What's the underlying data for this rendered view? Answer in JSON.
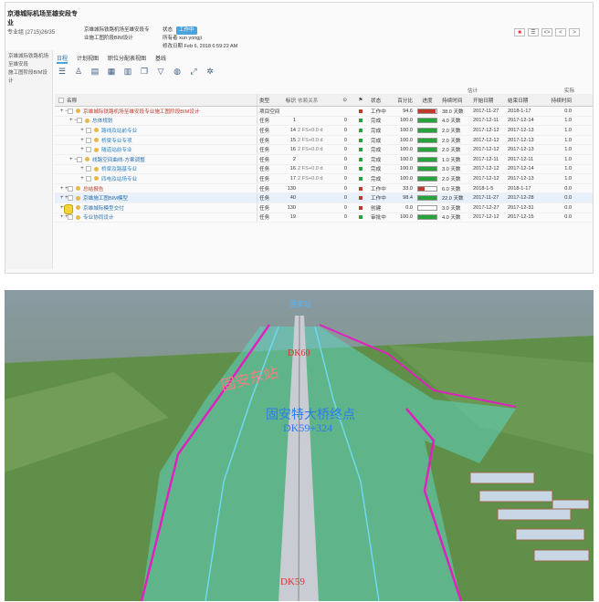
{
  "app": {
    "project_title": "京港城际机场至雄安段专业",
    "project_code": "专业组 (2715)26/35",
    "side_lines": [
      "京雄城际铁路机场至雄安段",
      "施工图阶段BIM设计"
    ],
    "project_desc": [
      "京雄城际铁路机场至雄安段专",
      "业施工图阶段BIM设计"
    ],
    "status_label": "状态",
    "status_value": "工作中",
    "owner_label": "所有者",
    "owner_value": "xun yongji",
    "modified_label": "修改日期",
    "modified_value": "Feb 6, 2018 6:59:22 AM",
    "window_buttons": [
      "■",
      "☰",
      "<>",
      "<",
      ">"
    ]
  },
  "tabs": [
    "日程",
    "计划视图",
    "职位分配表视图",
    "基线"
  ],
  "toolbar_icons": [
    "menu-icon",
    "person-icon",
    "doc-icon",
    "table-icon",
    "gantt-icon",
    "copy-icon",
    "filter-icon",
    "globe-icon",
    "expand-icon",
    "tools-icon"
  ],
  "grid": {
    "super_headers": {
      "estimate": "估计",
      "actual": "实际"
    },
    "headers": [
      "名称",
      "类型",
      "标识",
      "依赖关系",
      "⊙",
      "",
      "状态",
      "百分比",
      "进度",
      "持续时间",
      "开始日期",
      "结束日期",
      "持续时间"
    ],
    "rows": [
      {
        "exp": "+ −",
        "name": "京雄城际铁路机场至雄安段专业施工图阶段BIM设计",
        "type": "项目空间",
        "id": "",
        "dep": "",
        "zero": "",
        "flag": "#c0392b",
        "status": "工作中",
        "pct": "94.6",
        "fill": 0.95,
        "fillc": "#c0392b",
        "dur": "38.0 天数",
        "start": "2017-11-27",
        "end": "2018-1-17",
        "rem": "0.0",
        "cls": "red",
        "indent": 0
      },
      {
        "exp": "+ −",
        "name": "总体规划",
        "type": "任务",
        "id": "1",
        "dep": "",
        "zero": "0",
        "flag": "#27a33b",
        "status": "完成",
        "pct": "100.0",
        "fill": 1,
        "fillc": "#27a33b",
        "dur": "4.0 天数",
        "start": "2017-12-11",
        "end": "2017-12-14",
        "rem": "1.0",
        "cls": "lk",
        "indent": 1
      },
      {
        "exp": "+",
        "name": "路线及站前专业",
        "type": "任务",
        "id": "14",
        "dep": "2 FS+0.0 d",
        "zero": "0",
        "flag": "#27a33b",
        "status": "完成",
        "pct": "100.0",
        "fill": 1,
        "fillc": "#27a33b",
        "dur": "2.0 天数",
        "start": "2017-12-12",
        "end": "2017-12-13",
        "rem": "1.0",
        "cls": "lk2",
        "indent": 2
      },
      {
        "exp": "+",
        "name": "桥梁专业专项",
        "type": "任务",
        "id": "15",
        "dep": "2 FS+0.0 d",
        "zero": "0",
        "flag": "#27a33b",
        "status": "完成",
        "pct": "100.0",
        "fill": 1,
        "fillc": "#27a33b",
        "dur": "2.0 天数",
        "start": "2017-12-12",
        "end": "2017-12-13",
        "rem": "1.0",
        "cls": "lk2",
        "indent": 2
      },
      {
        "exp": "+",
        "name": "隧道站前专业",
        "type": "任务",
        "id": "16",
        "dep": "2 FS+0.0 d",
        "zero": "0",
        "flag": "#27a33b",
        "status": "完成",
        "pct": "100.0",
        "fill": 1,
        "fillc": "#27a33b",
        "dur": "2.0 天数",
        "start": "2017-12-12",
        "end": "2017-12-13",
        "rem": "1.0",
        "cls": "lk2",
        "indent": 2
      },
      {
        "exp": "+ −",
        "name": "线路空间曲线-方案调整",
        "type": "任务",
        "id": "2",
        "dep": "",
        "zero": "0",
        "flag": "#27a33b",
        "status": "完成",
        "pct": "100.0",
        "fill": 1,
        "fillc": "#27a33b",
        "dur": "1.0 天数",
        "start": "2017-12-11",
        "end": "2017-12-11",
        "rem": "1.0",
        "cls": "lk",
        "indent": 1
      },
      {
        "exp": "+",
        "name": "桥梁及路基专业",
        "type": "任务",
        "id": "16",
        "dep": "2 FS+0.0 d",
        "zero": "0",
        "flag": "#27a33b",
        "status": "完成",
        "pct": "100.0",
        "fill": 1,
        "fillc": "#27a33b",
        "dur": "3.0 天数",
        "start": "2017-12-12",
        "end": "2017-12-14",
        "rem": "1.0",
        "cls": "lk2",
        "indent": 2
      },
      {
        "exp": "+",
        "name": "四电及站场专业",
        "type": "任务",
        "id": "17",
        "dep": "2 FS+0.0 d",
        "zero": "0",
        "flag": "#27a33b",
        "status": "完成",
        "pct": "100.0",
        "fill": 1,
        "fillc": "#27a33b",
        "dur": "2.0 天数",
        "start": "2017-12-12",
        "end": "2017-12-13",
        "rem": "1.0",
        "cls": "lk2",
        "indent": 2
      },
      {
        "exp": "+ +",
        "name": "总结报告",
        "type": "任务",
        "id": "130",
        "dep": "",
        "zero": "0",
        "flag": "#c0392b",
        "status": "工作中",
        "pct": "33.0",
        "fill": 0.33,
        "fillc": "#c0392b",
        "dur": "6.0 天数",
        "start": "2018-1-5",
        "end": "2018-1-17",
        "rem": "0.0",
        "cls": "red",
        "indent": 0
      },
      {
        "exp": "+ +",
        "name": "京雄施工图BIM模型",
        "type": "任务",
        "id": "40",
        "dep": "",
        "zero": "0",
        "flag": "#c0392b",
        "status": "工作中",
        "pct": "98.4",
        "fill": 0.98,
        "fillc": "#27a33b",
        "dur": "22.0 天数",
        "start": "2017-11-27",
        "end": "2017-12-28",
        "rem": "0.0",
        "cls": "lk",
        "indent": 0
      },
      {
        "exp": "+ +",
        "name": "京雄城际模型交付",
        "type": "任务",
        "id": "130",
        "dep": "",
        "zero": "0",
        "flag": "#c0392b",
        "status": "创建",
        "pct": "0.0",
        "fill": 0,
        "fillc": "#27a33b",
        "dur": "3.0 天数",
        "start": "2017-12-27",
        "end": "2017-12-31",
        "rem": "0.0",
        "cls": "lk",
        "indent": 0
      },
      {
        "exp": "+ +",
        "name": "专业协同设计",
        "type": "任务",
        "id": "19",
        "dep": "",
        "zero": "0",
        "flag": "#27a33b",
        "status": "审批中",
        "pct": "100.0",
        "fill": 1,
        "fillc": "#27a33b",
        "dur": "4.0 天数",
        "start": "2017-12-12",
        "end": "2017-12-15",
        "rem": "0.0",
        "cls": "lk",
        "indent": 0
      }
    ]
  },
  "scene": {
    "station_label": "固安东站",
    "bridge_label": "固安特大桥终点",
    "bridge_mileage": "DK59+324",
    "mileage_top": "DK60",
    "mileage_bottom": "DK59",
    "far_label": "固安站"
  }
}
